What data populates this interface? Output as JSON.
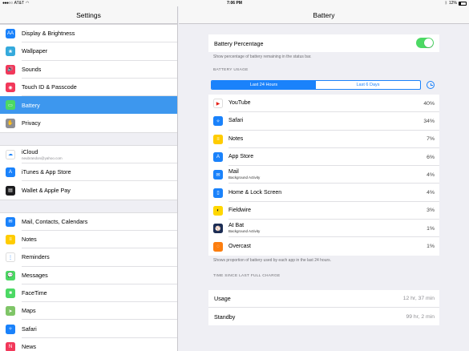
{
  "status_bar": {
    "carrier": "AT&T",
    "time": "7:06 PM",
    "battery_level": "12%"
  },
  "sidebar": {
    "title": "Settings",
    "groups": [
      [
        {
          "label": "Display & Brightness",
          "icon": "display-brightness-icon",
          "color": "#1a82fb",
          "glyph": "AA"
        },
        {
          "label": "Wallpaper",
          "icon": "wallpaper-icon",
          "color": "#35aadc",
          "glyph": "❀"
        },
        {
          "label": "Sounds",
          "icon": "sounds-icon",
          "color": "#f2385a",
          "glyph": "🔊"
        },
        {
          "label": "Touch ID & Passcode",
          "icon": "fingerprint-icon",
          "color": "#f2385a",
          "glyph": "◉"
        },
        {
          "label": "Battery",
          "icon": "battery-icon",
          "color": "#4cd964",
          "glyph": "▭",
          "selected": true
        },
        {
          "label": "Privacy",
          "icon": "privacy-hand-icon",
          "color": "#8e8e93",
          "glyph": "✋"
        }
      ],
      [
        {
          "label": "iCloud",
          "sub": "neubrandon@yahoo.com",
          "icon": "icloud-icon",
          "color": "#ffffff",
          "glyph": "☁"
        },
        {
          "label": "iTunes & App Store",
          "icon": "app-store-icon",
          "color": "#1a82fb",
          "glyph": "A"
        },
        {
          "label": "Wallet & Apple Pay",
          "icon": "wallet-icon",
          "color": "#1c1c1e",
          "glyph": "▤"
        }
      ],
      [
        {
          "label": "Mail, Contacts, Calendars",
          "icon": "mail-icon",
          "color": "#1a82fb",
          "glyph": "✉"
        },
        {
          "label": "Notes",
          "icon": "notes-icon",
          "color": "#ffcc00",
          "glyph": "≡"
        },
        {
          "label": "Reminders",
          "icon": "reminders-icon",
          "color": "#ffffff",
          "glyph": "⋮"
        },
        {
          "label": "Messages",
          "icon": "messages-icon",
          "color": "#4cd964",
          "glyph": "💬"
        },
        {
          "label": "FaceTime",
          "icon": "facetime-icon",
          "color": "#4cd964",
          "glyph": "■"
        },
        {
          "label": "Maps",
          "icon": "maps-icon",
          "color": "#7fc567",
          "glyph": "➤"
        },
        {
          "label": "Safari",
          "icon": "safari-icon",
          "color": "#1a82fb",
          "glyph": "✧"
        },
        {
          "label": "News",
          "icon": "news-icon",
          "color": "#f2385a",
          "glyph": "N"
        }
      ]
    ]
  },
  "detail": {
    "title": "Battery",
    "battery_percentage": {
      "label": "Battery Percentage",
      "on": true,
      "note": "Show percentage of battery remaining in the status bar."
    },
    "usage_section_label": "BATTERY USAGE",
    "tabs": {
      "last24": "Last 24 Hours",
      "last6": "Last 6 Days"
    },
    "apps": [
      {
        "name": "YouTube",
        "pct": "40%",
        "icon": "youtube-icon",
        "color": "#ffffff",
        "glyph": "▶",
        "glyph_color": "#e62117"
      },
      {
        "name": "Safari",
        "pct": "34%",
        "icon": "safari-icon",
        "color": "#1a82fb",
        "glyph": "✧",
        "glyph_color": "#ffffff"
      },
      {
        "name": "Notes",
        "pct": "7%",
        "icon": "notes-icon",
        "color": "#ffcc00",
        "glyph": "≡",
        "glyph_color": "#ffffff"
      },
      {
        "name": "App Store",
        "pct": "6%",
        "icon": "app-store-icon",
        "color": "#1a82fb",
        "glyph": "A",
        "glyph_color": "#ffffff"
      },
      {
        "name": "Mail",
        "sub": "Background Activity",
        "pct": "4%",
        "icon": "mail-icon",
        "color": "#1a82fb",
        "glyph": "✉",
        "glyph_color": "#ffffff"
      },
      {
        "name": "Home & Lock Screen",
        "pct": "4%",
        "icon": "home-lock-icon",
        "color": "#1a82fb",
        "glyph": "▯",
        "glyph_color": "#ffffff"
      },
      {
        "name": "Fieldwire",
        "pct": "3%",
        "icon": "fieldwire-icon",
        "color": "#ffd700",
        "glyph": "◐",
        "glyph_color": "#1c1c1e"
      },
      {
        "name": "At Bat",
        "sub": "Background Activity",
        "pct": "1%",
        "icon": "at-bat-icon",
        "color": "#1c2d54",
        "glyph": "⚾",
        "glyph_color": "#ffffff"
      },
      {
        "name": "Overcast",
        "pct": "1%",
        "icon": "overcast-icon",
        "color": "#fc7e0f",
        "glyph": "◌",
        "glyph_color": "#ffffff"
      }
    ],
    "usage_note": "Shows proportion of battery used by each app in the last 24 hours.",
    "time_section_label": "TIME SINCE LAST FULL CHARGE",
    "usage_time": {
      "label": "Usage",
      "value": "12 hr, 37 min"
    },
    "standby_time": {
      "label": "Standby",
      "value": "99 hr, 2 min"
    }
  }
}
